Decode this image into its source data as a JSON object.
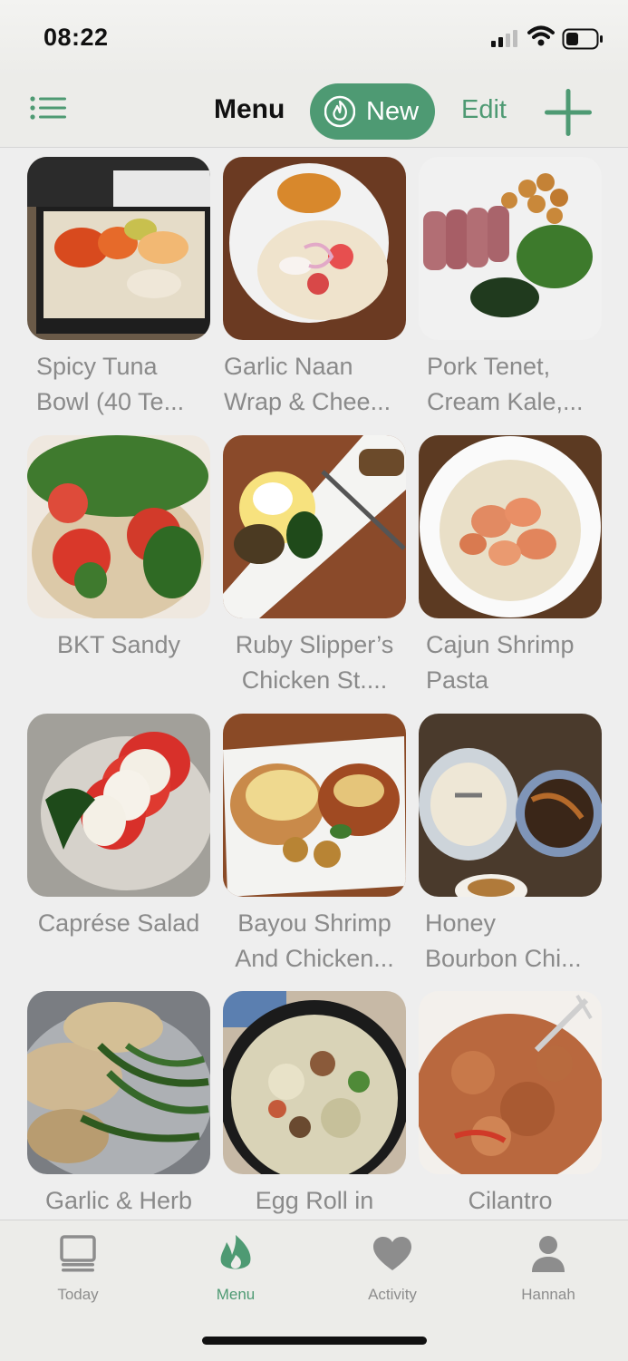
{
  "status": {
    "time": "08:22"
  },
  "nav": {
    "title": "Menu",
    "new_label": "New",
    "edit_label": "Edit",
    "accent": "#4e9a73"
  },
  "menu": {
    "items": [
      {
        "line1": "Spicy Tuna",
        "line2": "Bowl (40 Te..."
      },
      {
        "line1": "Garlic Naan",
        "line2": "Wrap & Chee..."
      },
      {
        "line1": "Pork Tenet,",
        "line2": "Cream Kale,..."
      },
      {
        "line1": "BKT Sandy",
        "line2": ""
      },
      {
        "line1": "Ruby Slipper’s",
        "line2": "Chicken St...."
      },
      {
        "line1": "Cajun Shrimp",
        "line2": "Pasta"
      },
      {
        "line1": "Caprése Salad",
        "line2": ""
      },
      {
        "line1": "Bayou Shrimp",
        "line2": "And Chicken..."
      },
      {
        "line1": "Honey",
        "line2": "Bourbon Chi..."
      },
      {
        "line1": "Garlic & Herb",
        "line2": ""
      },
      {
        "line1": "Egg Roll in",
        "line2": ""
      },
      {
        "line1": "Cilantro",
        "line2": ""
      }
    ]
  },
  "tabs": [
    {
      "label": "Today",
      "icon": "laptop-icon"
    },
    {
      "label": "Menu",
      "icon": "flame-icon",
      "active": true
    },
    {
      "label": "Activity",
      "icon": "heart-icon"
    },
    {
      "label": "Hannah",
      "icon": "person-icon"
    }
  ]
}
